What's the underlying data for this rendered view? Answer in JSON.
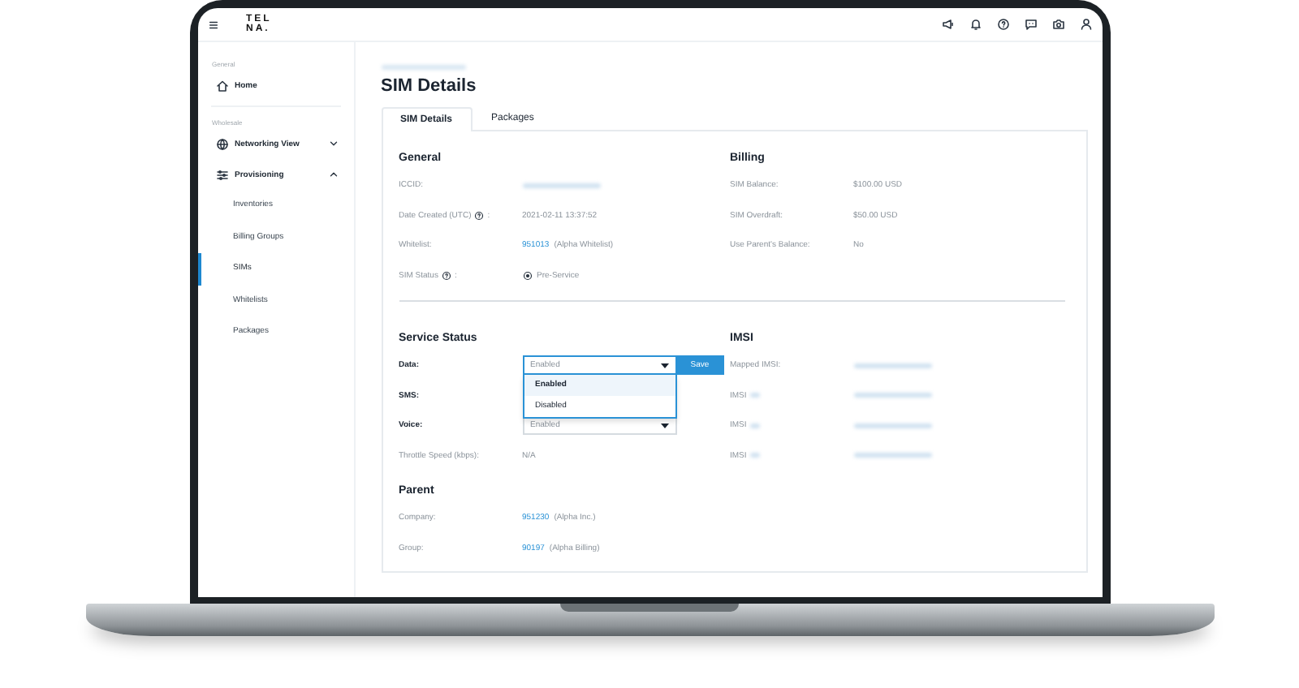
{
  "logo": {
    "lines": [
      "TEL",
      "NA."
    ]
  },
  "sidebar": {
    "sections": [
      {
        "heading": "General",
        "items": [
          {
            "label": "Home",
            "selected": false
          }
        ]
      },
      {
        "heading": "Wholesale",
        "items": [
          {
            "label": "Networking View",
            "selected": false,
            "expanded": false
          },
          {
            "label": "Provisioning",
            "selected": false,
            "expanded": true,
            "children": [
              {
                "label": "Inventories",
                "selected": false
              },
              {
                "label": "Billing Groups",
                "selected": false
              },
              {
                "label": "SIMs",
                "selected": true
              },
              {
                "label": "Whitelists",
                "selected": false
              },
              {
                "label": "Packages",
                "selected": false
              }
            ]
          }
        ]
      }
    ]
  },
  "page": {
    "title": "SIM Details"
  },
  "tabs": [
    {
      "label": "SIM Details",
      "selected": true
    },
    {
      "label": "Packages",
      "selected": false
    }
  ],
  "general": {
    "heading": "General",
    "rows": [
      {
        "label": "ICCID:",
        "help": false,
        "kind": "redacted"
      },
      {
        "label": "Date Created (UTC)",
        "help": true,
        "suffix": ":",
        "kind": "text",
        "value": "2021-02-11  13:37:52"
      },
      {
        "label": "Whitelist:",
        "help": false,
        "kind": "link",
        "link": "951013",
        "value": "(Alpha Whitelist)"
      },
      {
        "label": "SIM Status",
        "help": true,
        "suffix": ":",
        "kind": "status",
        "value": "Pre-Service"
      }
    ]
  },
  "billing": {
    "heading": "Billing",
    "rows": [
      {
        "label": "SIM Balance:",
        "value": "$100.00 USD"
      },
      {
        "label": "SIM Overdraft:",
        "value": "$50.00 USD"
      },
      {
        "label": "Use Parent's Balance:",
        "value": "No"
      }
    ]
  },
  "service_status": {
    "heading": "Service Status",
    "rows": [
      {
        "label": "Data:",
        "kind": "select",
        "value": "Enabled",
        "expanded": true,
        "button": "Save",
        "options": [
          {
            "label": "Enabled",
            "selected": true
          },
          {
            "label": "Disabled",
            "selected": false
          }
        ]
      },
      {
        "label": "SMS:",
        "kind": "hidden"
      },
      {
        "label": "Voice:",
        "kind": "select",
        "value": "Enabled",
        "expanded": false
      },
      {
        "label": "Throttle Speed (kbps):",
        "kind": "text",
        "value": "N/A"
      }
    ]
  },
  "imsi": {
    "heading": "IMSI",
    "rows": [
      {
        "label": "Mapped IMSI:"
      },
      {
        "label": "IMSI"
      },
      {
        "label": "IMSI"
      },
      {
        "label": "IMSI"
      }
    ]
  },
  "parent": {
    "heading": "Parent",
    "rows": [
      {
        "label": "Company:",
        "link": "951230",
        "value": "(Alpha Inc.)"
      },
      {
        "label": "Group:",
        "link": "90197",
        "value": "(Alpha Billing)"
      }
    ]
  }
}
